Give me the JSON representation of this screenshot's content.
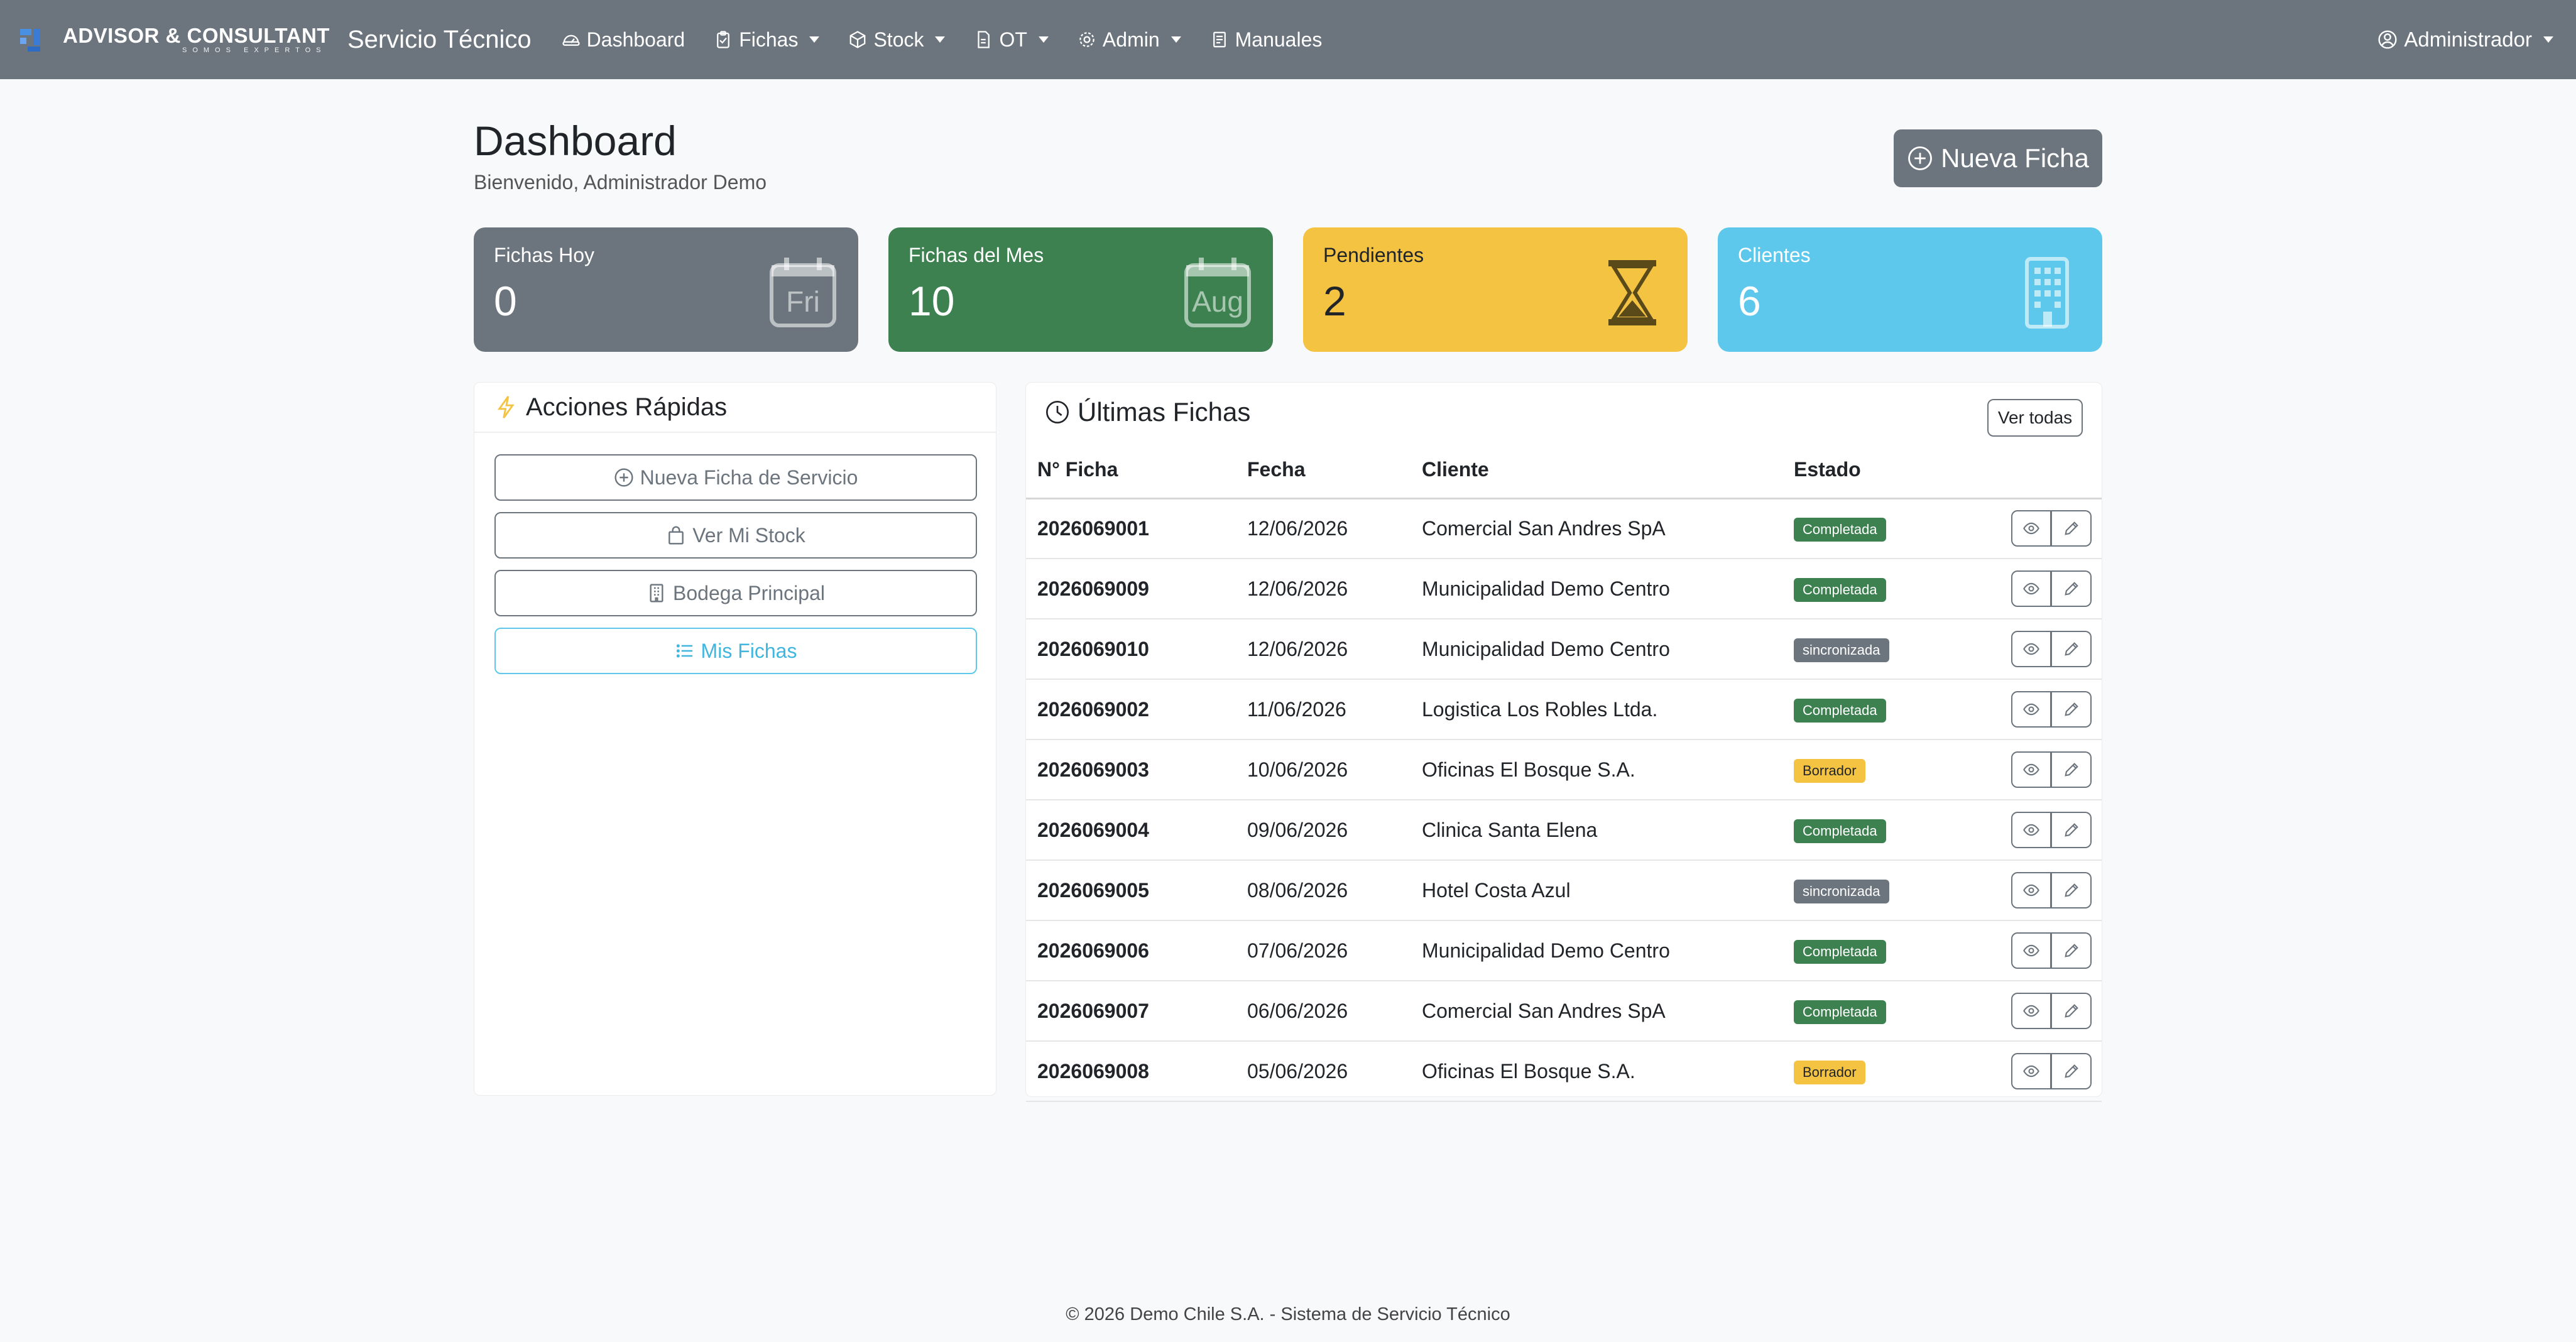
{
  "navbar": {
    "brand_name": "ADVISOR & CONSULTANT",
    "brand_slogan": "SOMOS EXPERTOS",
    "app_title": "Servicio Técnico",
    "items": [
      {
        "label": "Dashboard",
        "icon": "speedometer-icon",
        "dropdown": false
      },
      {
        "label": "Fichas",
        "icon": "clipboard-icon",
        "dropdown": true
      },
      {
        "label": "Stock",
        "icon": "box-icon",
        "dropdown": true
      },
      {
        "label": "OT",
        "icon": "document-icon",
        "dropdown": true
      },
      {
        "label": "Admin",
        "icon": "gear-icon",
        "dropdown": true
      },
      {
        "label": "Manuales",
        "icon": "book-icon",
        "dropdown": false
      }
    ],
    "user": "Administrador"
  },
  "header": {
    "title": "Dashboard",
    "subtitle": "Bienvenido, Administrador Demo",
    "new_button": "Nueva Ficha"
  },
  "stats": [
    {
      "label": "Fichas Hoy",
      "value": "0",
      "icon_text": "Fri",
      "color": "#6c757d"
    },
    {
      "label": "Fichas del Mes",
      "value": "10",
      "icon_text": "Aug",
      "color": "#3d8150"
    },
    {
      "label": "Pendientes",
      "value": "2",
      "icon": "hourglass-icon",
      "color": "#f5c342"
    },
    {
      "label": "Clientes",
      "value": "6",
      "icon": "building-icon",
      "color": "#5ec8ec"
    }
  ],
  "quick_actions": {
    "title": "Acciones Rápidas",
    "buttons": [
      {
        "label": "Nueva Ficha de Servicio",
        "icon": "plus-circle-icon"
      },
      {
        "label": "Ver Mi Stock",
        "icon": "bag-icon"
      },
      {
        "label": "Bodega Principal",
        "icon": "building-icon"
      },
      {
        "label": "Mis Fichas",
        "icon": "list-icon"
      }
    ]
  },
  "latest": {
    "title": "Últimas Fichas",
    "view_all": "Ver todas",
    "columns": [
      "N° Ficha",
      "Fecha",
      "Cliente",
      "Estado"
    ],
    "rows": [
      {
        "num": "2026069001",
        "fecha": "12/06/2026",
        "cliente": "Comercial San Andres SpA",
        "estado": "Completada"
      },
      {
        "num": "2026069009",
        "fecha": "12/06/2026",
        "cliente": "Municipalidad Demo Centro",
        "estado": "Completada"
      },
      {
        "num": "2026069010",
        "fecha": "12/06/2026",
        "cliente": "Municipalidad Demo Centro",
        "estado": "sincronizada"
      },
      {
        "num": "2026069002",
        "fecha": "11/06/2026",
        "cliente": "Logistica Los Robles Ltda.",
        "estado": "Completada"
      },
      {
        "num": "2026069003",
        "fecha": "10/06/2026",
        "cliente": "Oficinas El Bosque S.A.",
        "estado": "Borrador"
      },
      {
        "num": "2026069004",
        "fecha": "09/06/2026",
        "cliente": "Clinica Santa Elena",
        "estado": "Completada"
      },
      {
        "num": "2026069005",
        "fecha": "08/06/2026",
        "cliente": "Hotel Costa Azul",
        "estado": "sincronizada"
      },
      {
        "num": "2026069006",
        "fecha": "07/06/2026",
        "cliente": "Municipalidad Demo Centro",
        "estado": "Completada"
      },
      {
        "num": "2026069007",
        "fecha": "06/06/2026",
        "cliente": "Comercial San Andres SpA",
        "estado": "Completada"
      },
      {
        "num": "2026069008",
        "fecha": "05/06/2026",
        "cliente": "Oficinas El Bosque S.A.",
        "estado": "Borrador"
      }
    ]
  },
  "footer": "© 2026 Demo Chile S.A. - Sistema de Servicio Técnico"
}
